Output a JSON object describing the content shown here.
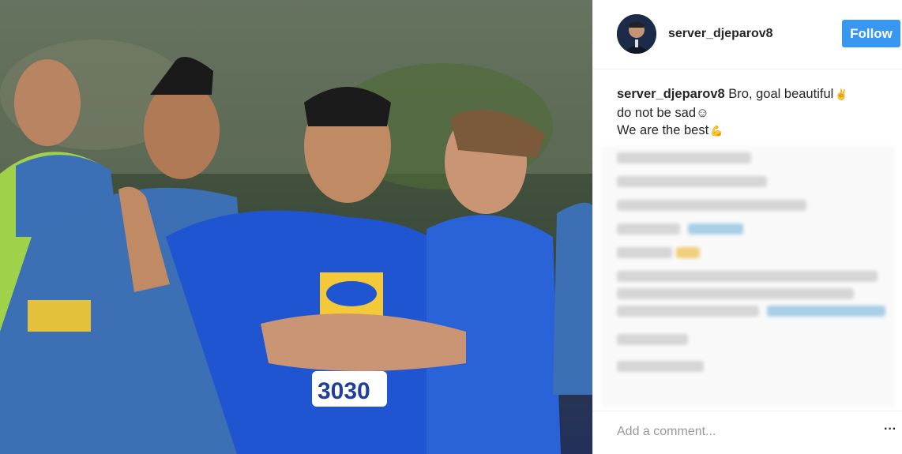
{
  "post": {
    "image_alt": "Football players in blue kits celebrating on the pitch"
  },
  "header": {
    "username": "server_djeparov8",
    "follow_label": "Follow"
  },
  "caption": {
    "username": "server_djeparov8",
    "line1": "Bro, goal beautiful",
    "line2": "do not be sad",
    "line2_emoji": "☺",
    "line3": "We are the best"
  },
  "comment_bar": {
    "placeholder": "Add a comment...",
    "more_label": "···"
  },
  "colors": {
    "follow_button": "#3897f0",
    "text": "#262626",
    "placeholder": "#999999",
    "border": "#efefef"
  }
}
